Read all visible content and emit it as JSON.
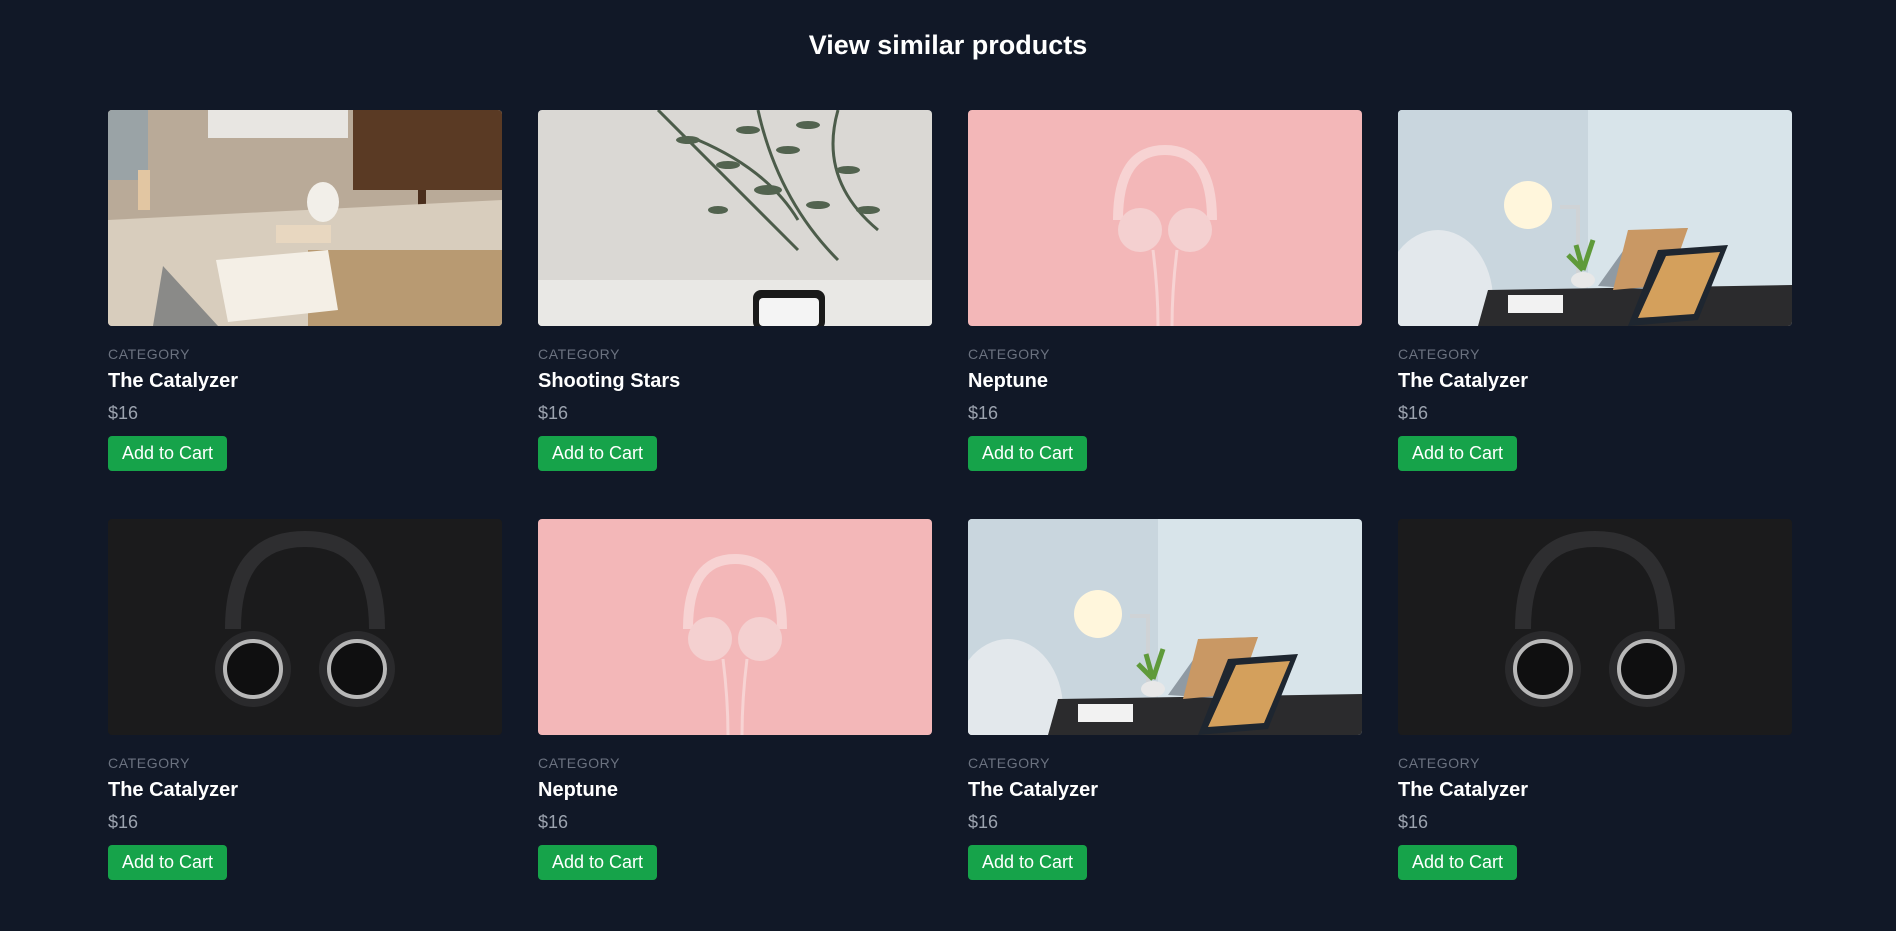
{
  "section": {
    "title": "View similar products"
  },
  "products": [
    {
      "category": "CATEGORY",
      "name": "The Catalyzer",
      "price": "$16",
      "button": "Add to Cart",
      "image": "book-room"
    },
    {
      "category": "CATEGORY",
      "name": "Shooting Stars",
      "price": "$16",
      "button": "Add to Cart",
      "image": "plant-phone"
    },
    {
      "category": "CATEGORY",
      "name": "Neptune",
      "price": "$16",
      "button": "Add to Cart",
      "image": "pink-headphones"
    },
    {
      "category": "CATEGORY",
      "name": "The Catalyzer",
      "price": "$16",
      "button": "Add to Cart",
      "image": "desk-laptops"
    },
    {
      "category": "CATEGORY",
      "name": "The Catalyzer",
      "price": "$16",
      "button": "Add to Cart",
      "image": "black-headphones"
    },
    {
      "category": "CATEGORY",
      "name": "Neptune",
      "price": "$16",
      "button": "Add to Cart",
      "image": "pink-headphones"
    },
    {
      "category": "CATEGORY",
      "name": "The Catalyzer",
      "price": "$16",
      "button": "Add to Cart",
      "image": "desk-laptops"
    },
    {
      "category": "CATEGORY",
      "name": "The Catalyzer",
      "price": "$16",
      "button": "Add to Cart",
      "image": "black-headphones"
    }
  ],
  "colors": {
    "background": "#111827",
    "button": "#16a34a",
    "category": "#6b7280",
    "price": "#9ca3af"
  }
}
